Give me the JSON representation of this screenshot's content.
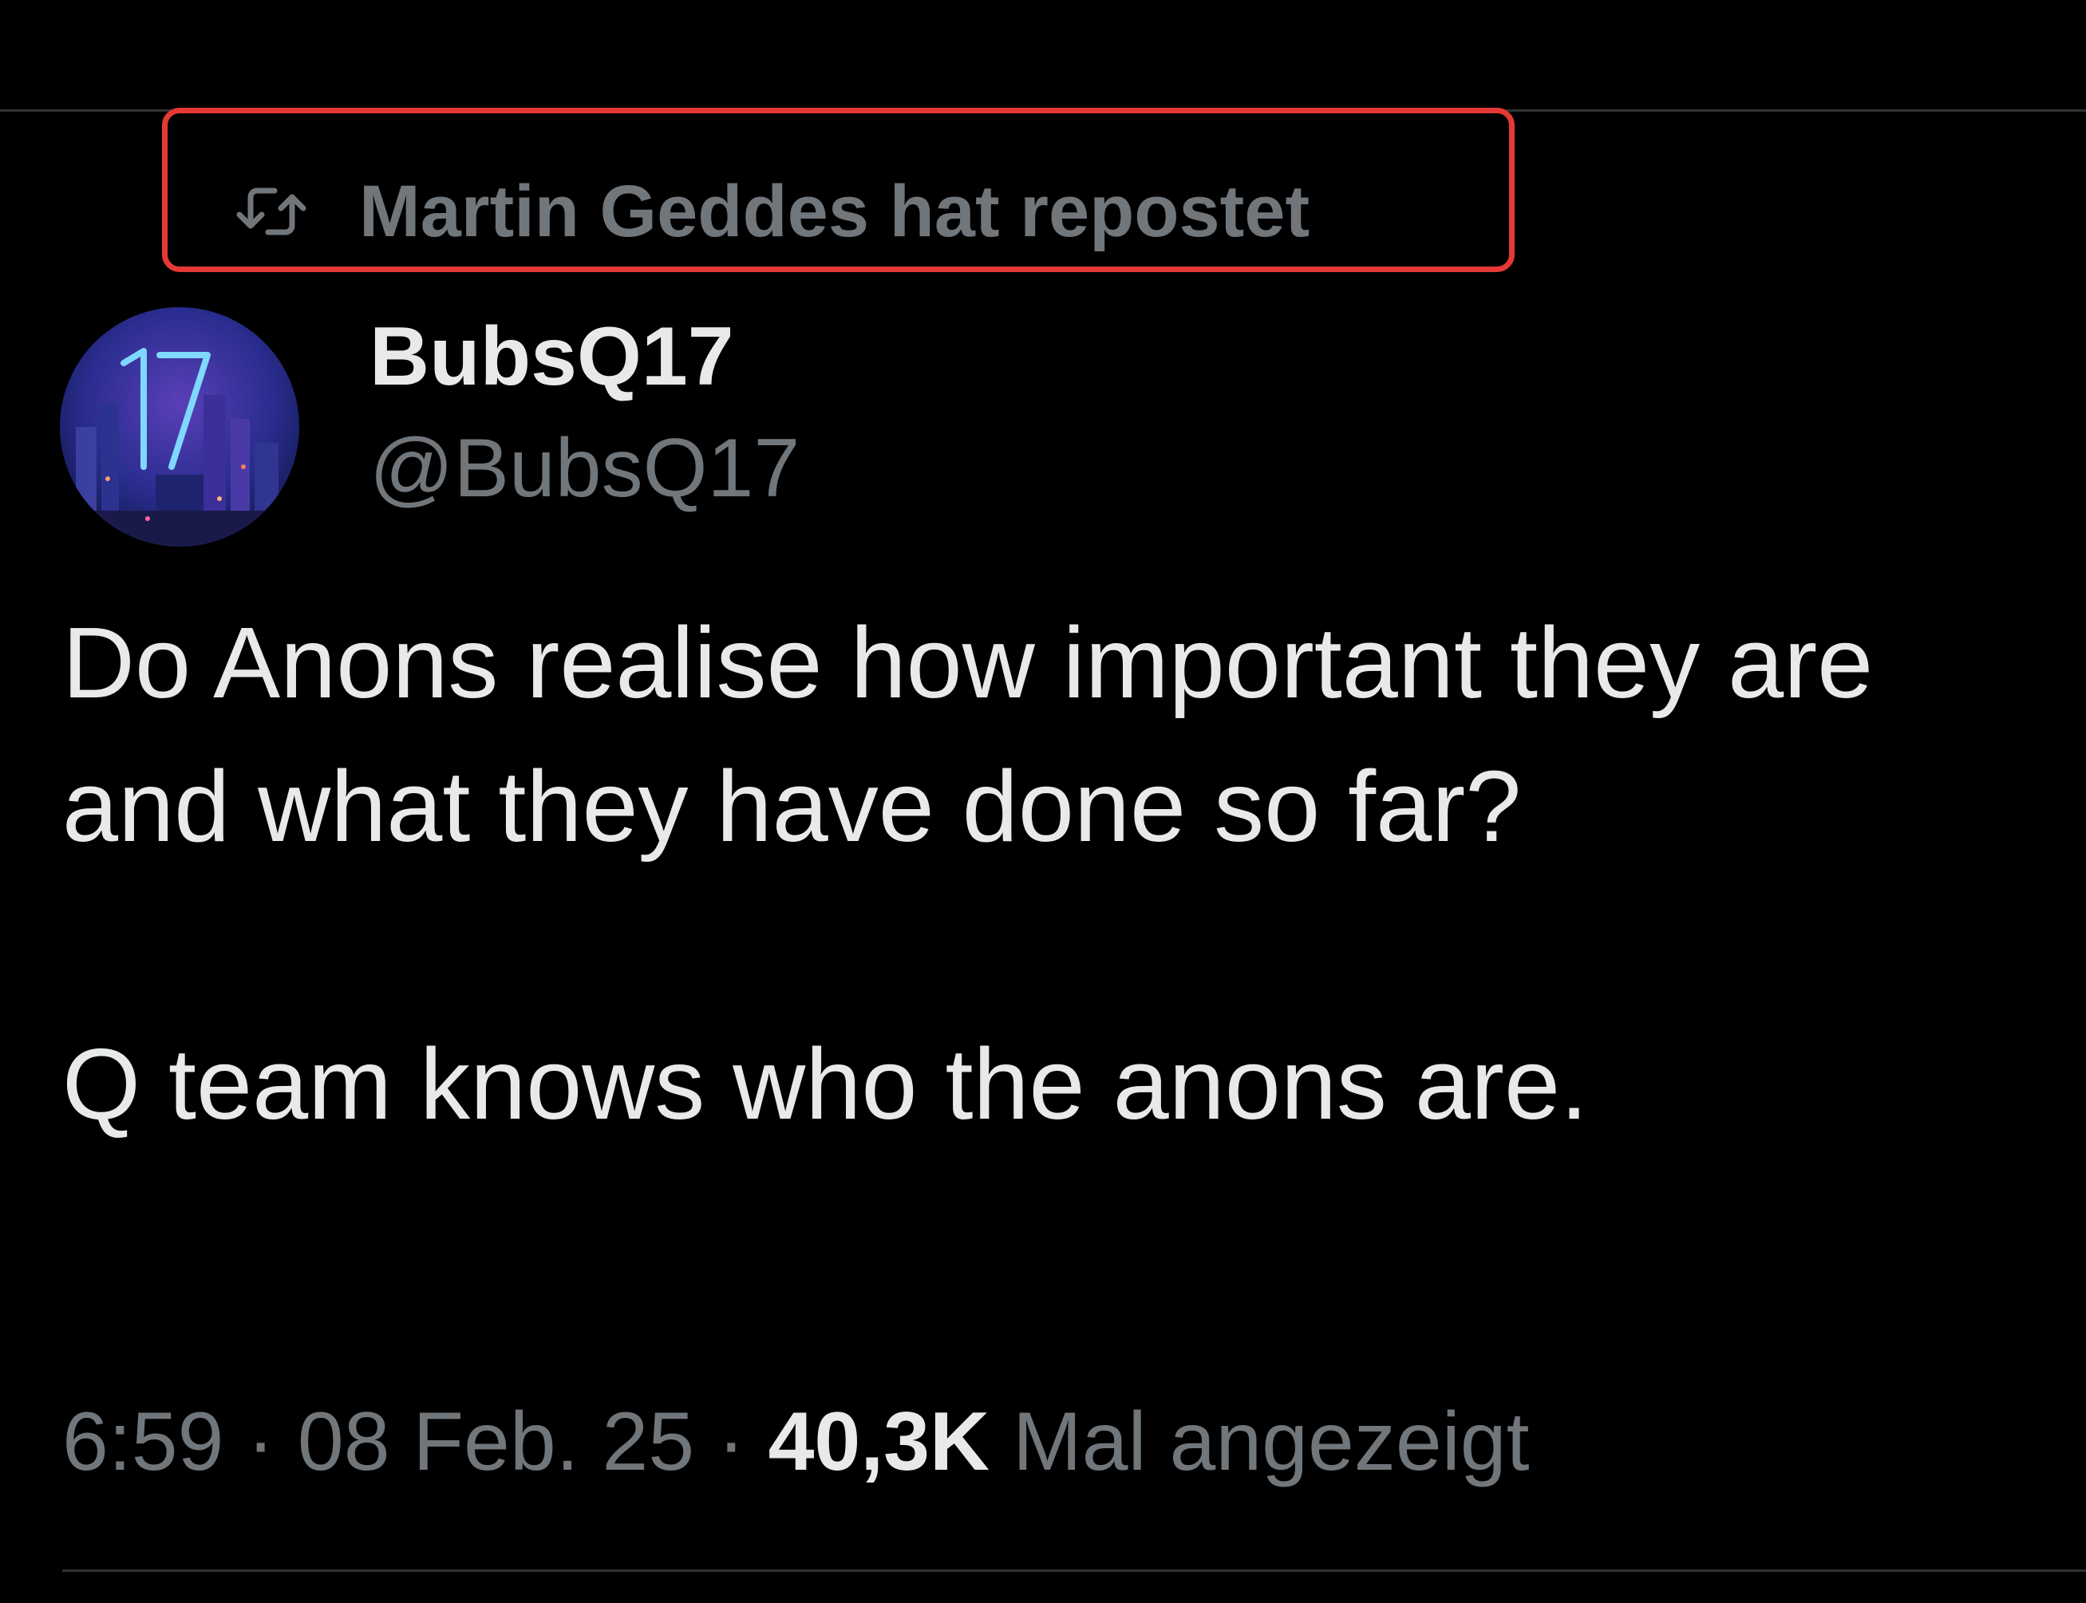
{
  "repost": {
    "icon": "repost-icon",
    "label": "Martin Geddes hat repostet",
    "highlight_color": "#e53935"
  },
  "author": {
    "display_name": "BubsQ17",
    "handle": "@BubsQ17",
    "avatar_text": "17"
  },
  "tweet": {
    "lines": [
      "Do Anons realise how important they are",
      "and what they have done so far?",
      "Q team knows who the anons are."
    ]
  },
  "meta": {
    "time": "6:59",
    "separator": "·",
    "date": "08 Feb. 25",
    "views_count": "40,3K",
    "views_label": "Mal angezeigt"
  },
  "colors": {
    "background": "#000000",
    "primary_text": "#e7e9ea",
    "secondary_text": "#71767b",
    "divider": "#2f3336"
  }
}
